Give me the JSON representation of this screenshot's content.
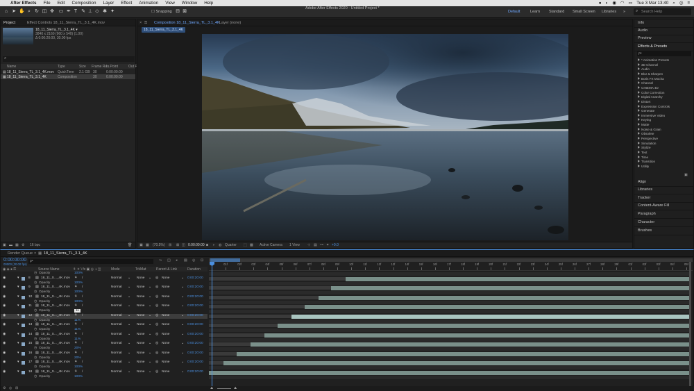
{
  "menubar": {
    "apple": "",
    "app_name": "After Effects",
    "items": [
      "File",
      "Edit",
      "Composition",
      "Layer",
      "Effect",
      "Animation",
      "View",
      "Window",
      "Help"
    ],
    "clock": "Tue 3 Mar",
    "time": "13:40"
  },
  "toolbar": {
    "window_title": "Adobe After Effects 2020 - Untitled Project *",
    "snapping_label": "Snapping",
    "workspaces": [
      "Default",
      "Learn",
      "Standard",
      "Small Screen",
      "Libraries"
    ],
    "search_placeholder": "Search Help"
  },
  "project_panel": {
    "tab_project": "Project",
    "tab_effect_controls": "Effect Controls 18_11_Sierra_TL_3.1_4K.mov",
    "preview_name": "18_11_Sierra_TL_3.1_4K ▾",
    "preview_info1": "3840 x 2160 (960 x 540) (1.00)",
    "preview_info2": "Δ 0:00:20:00, 30.00 fps",
    "columns": [
      "Name",
      "Type",
      "Size",
      "Frame Ra...",
      "In Point",
      "Out P"
    ],
    "files": [
      {
        "name": "18_11_Sierra_TL_3.1_4K.mov",
        "type": "QuickTime",
        "size": "2.1 GB",
        "fps": "30",
        "in": "0:00:00:00"
      },
      {
        "name": "18_11_Sierra_TL_3.1_4K",
        "type": "Composition",
        "size": "",
        "fps": "30",
        "in": "0:00:00:00"
      }
    ],
    "bpc": "16 bpc"
  },
  "composition_panel": {
    "tab": "Composition 18_11_Sierra_TL_3.1_4K",
    "layer_tab": "Layer (none)",
    "comp_name_tab": "18_11_Sierra_TL_3.1_4K",
    "zoom": "(70.5%)",
    "timecode": "0:00:00:00",
    "resolution": "Quarter",
    "camera": "Active Camera",
    "views": "1 View",
    "exposure": "+0.0"
  },
  "right_panel": {
    "sections_top": [
      "Info",
      "Audio",
      "Preview"
    ],
    "effects_title": "Effects & Presets",
    "effects_search": "ρ•",
    "effects": [
      "* Animation Presets",
      "3D Channel",
      "Audio",
      "Blur & Sharpen",
      "Boris FX Mocha",
      "Channel",
      "CINEMA 4D",
      "Color Correction",
      "Digital Anarchy",
      "Distort",
      "Expression Controls",
      "Generate",
      "Immersive Video",
      "Keying",
      "Matte",
      "Noise & Grain",
      "Obsolete",
      "Perspective",
      "Simulation",
      "Stylize",
      "Text",
      "Time",
      "Transition",
      "Utility"
    ],
    "sections_bottom": [
      "Align",
      "Libraries",
      "Tracker",
      "Content-Aware Fill",
      "Paragraph",
      "Character",
      "Brushes"
    ]
  },
  "timeline": {
    "tab_render_queue": "Render Queue",
    "tab_comp": "18_11_Sierra_TL_3.1_4K",
    "current_time": "0:00:00:00",
    "fps_info": "00000 (30.00 fps)",
    "search_placeholder": "ρ•",
    "columns": {
      "source": "Source Name",
      "mode": "Mode",
      "trkmat": "TrkMat",
      "parent": "Parent & Link",
      "duration": "Duration"
    },
    "ruler_labels": [
      "0f",
      "01f",
      "02f",
      "03f",
      "04f",
      "05f",
      "06f",
      "07f",
      "08f",
      "09f",
      "10f",
      "11f",
      "12f",
      "13f",
      "14f",
      "15f",
      "16f",
      "17f",
      "18f",
      "19f",
      "20f",
      "21f",
      "22f",
      "23f",
      "24f",
      "25f",
      "26f",
      "27f",
      "28f",
      "29f",
      "01f",
      "02f",
      "03f",
      "04f",
      "05f"
    ],
    "rows": [
      {
        "kind": "prop",
        "label": "Opacity",
        "value": "100%"
      },
      {
        "kind": "layer",
        "num": "8",
        "name": "18_11_S..._4K.mov",
        "mode": "Normal",
        "trkmat": "None",
        "parent": "None",
        "duration": "0:00:20:00",
        "start": 0.285
      },
      {
        "kind": "prop",
        "label": "Opacity",
        "value": "100%"
      },
      {
        "kind": "layer",
        "num": "9",
        "name": "18_11_S..._4K.mov",
        "mode": "Normal",
        "trkmat": "None",
        "parent": "None",
        "duration": "0:00:20:00",
        "start": 0.255
      },
      {
        "kind": "prop",
        "label": "Opacity",
        "value": "100%"
      },
      {
        "kind": "layer",
        "num": "10",
        "name": "18_11_S..._4K.mov",
        "mode": "Normal",
        "trkmat": "None",
        "parent": "None",
        "duration": "0:00:20:00",
        "start": 0.228
      },
      {
        "kind": "prop",
        "label": "Opacity",
        "value": "100%"
      },
      {
        "kind": "layer",
        "num": "11",
        "name": "18_11_S..._4K.mov",
        "mode": "Normal",
        "trkmat": "None",
        "parent": "None",
        "duration": "0:00:20:00",
        "start": 0.2
      },
      {
        "kind": "prop",
        "label": "Opacity",
        "value": "11"
      },
      {
        "kind": "layer",
        "num": "12",
        "name": "18_11_S..._4K.mov",
        "mode": "Normal",
        "trkmat": "None",
        "parent": "None",
        "duration": "0:00:20:00",
        "start": 0.172,
        "selected": true
      },
      {
        "kind": "prop",
        "label": "Opacity",
        "value": "11%"
      },
      {
        "kind": "layer",
        "num": "13",
        "name": "18_11_S..._4K.mov",
        "mode": "Normal",
        "trkmat": "None",
        "parent": "None",
        "duration": "0:00:20:00",
        "start": 0.143
      },
      {
        "kind": "prop",
        "label": "Opacity",
        "value": "11%"
      },
      {
        "kind": "layer",
        "num": "14",
        "name": "18_11_S..._4K.mov",
        "mode": "Normal",
        "trkmat": "None",
        "parent": "None",
        "duration": "0:00:20:00",
        "start": 0.115
      },
      {
        "kind": "prop",
        "label": "Opacity",
        "value": "11%"
      },
      {
        "kind": "layer",
        "num": "15",
        "name": "18_11_S..._4K.mov",
        "mode": "Normal",
        "trkmat": "None",
        "parent": "None",
        "duration": "0:00:20:00",
        "start": 0.086
      },
      {
        "kind": "prop",
        "label": "Opacity",
        "value": "20%"
      },
      {
        "kind": "layer",
        "num": "16",
        "name": "18_11_S..._4K.mov",
        "mode": "Normal",
        "trkmat": "None",
        "parent": "None",
        "duration": "0:00:20:00",
        "start": 0.058
      },
      {
        "kind": "prop",
        "label": "Opacity",
        "value": "20%"
      },
      {
        "kind": "layer",
        "num": "17",
        "name": "18_11_S..._4K.mov",
        "mode": "Normal",
        "trkmat": "None",
        "parent": "None",
        "duration": "0:00:20:00",
        "start": 0.03
      },
      {
        "kind": "prop",
        "label": "Opacity",
        "value": "100%"
      },
      {
        "kind": "layer",
        "num": "18",
        "name": "18_11_S..._4K.mov",
        "mode": "Normal",
        "trkmat": "None",
        "parent": "None",
        "duration": "0:00:20:00",
        "start": 0.0
      },
      {
        "kind": "prop",
        "label": "Opacity",
        "value": "100%"
      }
    ],
    "colors": {
      "bar": "#7a908a",
      "bar_selected": "#a9c5c0",
      "track_dark": "#2a2a2a",
      "track_light": "#3a3a3a",
      "accent": "#4a8fe0"
    }
  }
}
